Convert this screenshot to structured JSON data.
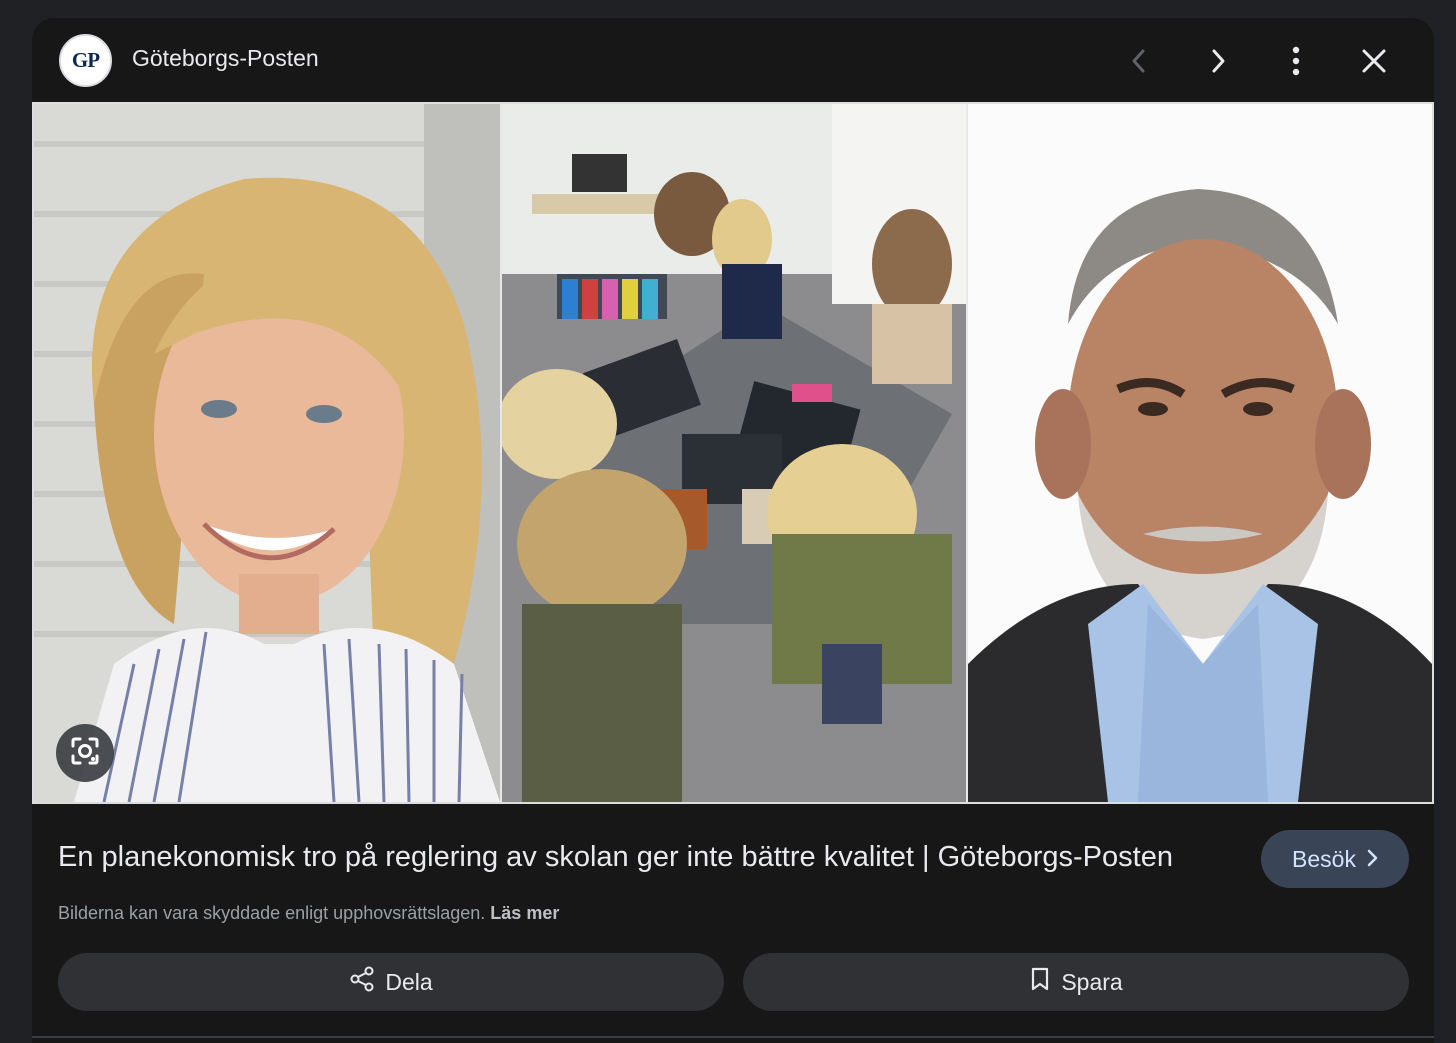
{
  "header": {
    "logo_text": "GP",
    "source_name": "Göteborgs-Posten",
    "icons": [
      "chevron-left-icon",
      "chevron-right-icon",
      "more-vert-icon",
      "close-icon"
    ]
  },
  "images": {
    "lens_icon": "google-lens-icon"
  },
  "result": {
    "title": "En planekonomisk tro på reglering av skolan ger inte bättre kvalitet | Göteborgs-Posten",
    "visit_label": "Besök",
    "copyright_text": "Bilderna kan vara skyddade enligt upphovsrättslagen.",
    "read_more": "Läs mer"
  },
  "actions": {
    "share_label": "Dela",
    "save_label": "Spara"
  },
  "colors": {
    "background": "#171717",
    "visit_button": "#394457",
    "action_button": "#303134"
  }
}
